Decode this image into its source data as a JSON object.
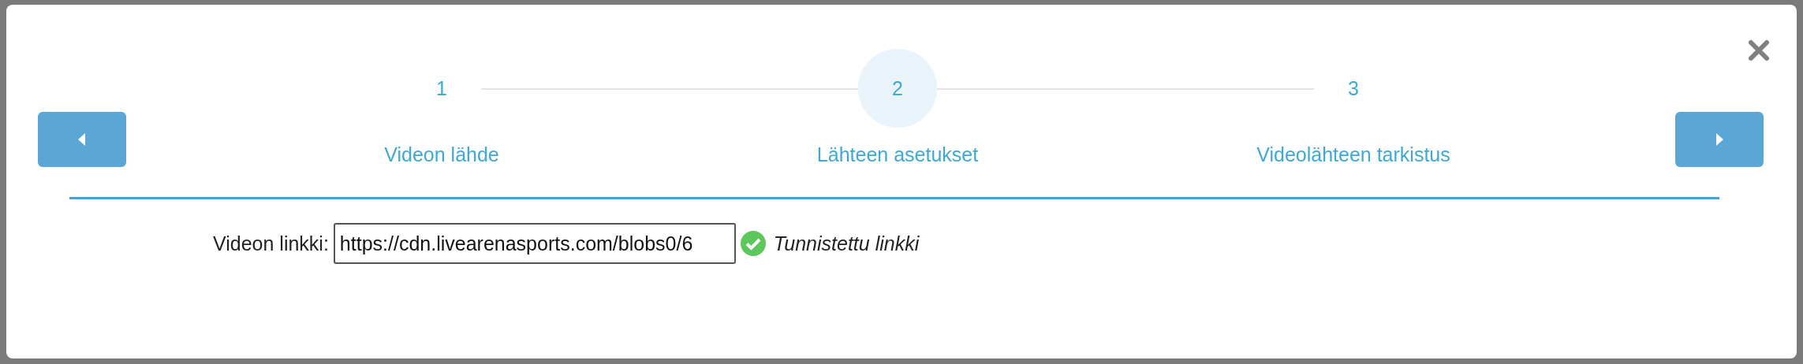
{
  "steps": [
    {
      "number": "1",
      "label": "Videon lähde",
      "selected": false
    },
    {
      "number": "2",
      "label": "Lähteen asetukset",
      "selected": true
    },
    {
      "number": "3",
      "label": "Videolähteen tarkistus",
      "selected": false
    }
  ],
  "field": {
    "label": "Videon linkki:",
    "value": "https://cdn.livearenasports.com/blobs0/6"
  },
  "status": {
    "text": "Tunnistettu linkki",
    "valid": true
  }
}
